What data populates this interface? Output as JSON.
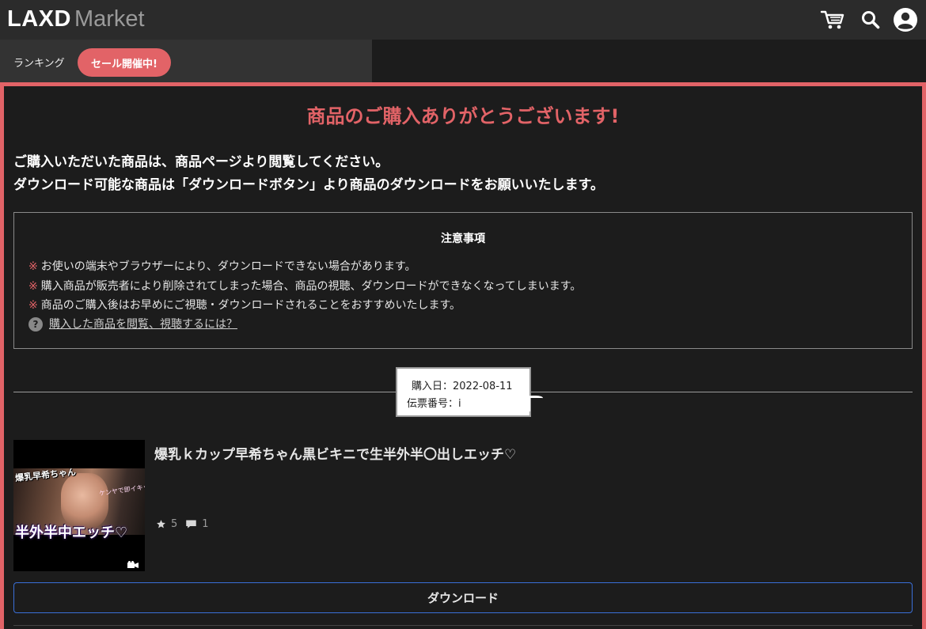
{
  "header": {
    "logo_bold": "LAXD",
    "logo_light": "Market",
    "icons": [
      "cart-icon",
      "search-icon",
      "account-icon"
    ]
  },
  "subnav": {
    "ranking_label": "ランキング",
    "sale_label": "セール開催中!"
  },
  "main": {
    "thanks_title": "商品のご購入ありがとうございます!",
    "message_line1": "ご購入いただいた商品は、商品ページより閲覧してください。",
    "message_line2": "ダウンロード可能な商品は「ダウンロードボタン」より商品のダウンロードをお願いいたします。"
  },
  "notice": {
    "title": "注意事項",
    "mark": "※",
    "items": [
      "お使いの端末やブラウザーにより、ダウンロードできない場合があります。",
      "購入商品が販売者により削除されてしまった場合、商品の視聴、ダウンロードができなくなってしまいます。",
      "商品のご購入後はお早めにご視聴・ダウンロードされることをおすすめいたします。"
    ],
    "help_link": "購入した商品を閲覧、視聴するには？"
  },
  "purchase": {
    "date_label": "購入日：",
    "date_value": "2022-08-11",
    "invoice_label": "伝票番号：",
    "invoice_value": "i"
  },
  "product": {
    "title": "爆乳ｋカップ早希ちゃん黒ビキニで生半外半〇出しエッチ♡",
    "thumb_text_top": "爆乳早希ちゃん",
    "thumb_text_side": "ケンヤで即イキッ",
    "thumb_text_bottom": "半外半中エッチ♡",
    "rating": "5",
    "comments": "1",
    "download_label": "ダウンロード"
  },
  "colors": {
    "accent": "#e26367",
    "header_bg": "#2b2b2b",
    "page_bg": "#1c1c1c",
    "button_border": "#3a6fd8"
  }
}
